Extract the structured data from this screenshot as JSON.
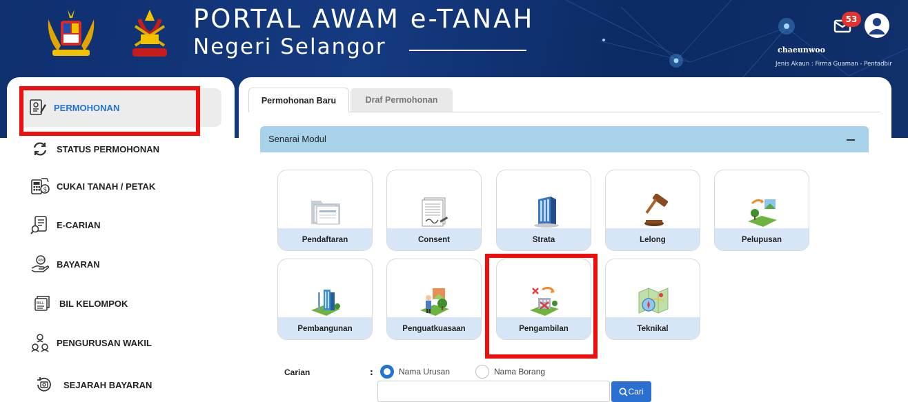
{
  "header": {
    "title": "PORTAL AWAM e-TANAH",
    "subtitle": "Negeri Selangor",
    "notification_count": "53",
    "username": "chaeunwoo",
    "account_type": "Jenis Akaun : Firma Guaman - Pentadbir"
  },
  "sidebar": {
    "items": [
      {
        "label": "PERMOHONAN",
        "icon": "application-form-icon",
        "active": true
      },
      {
        "label": "STATUS PERMOHONAN",
        "icon": "refresh-icon"
      },
      {
        "label": "CUKAI TANAH / PETAK",
        "icon": "tax-calculator-icon"
      },
      {
        "label": "E-CARIAN",
        "icon": "document-search-icon"
      },
      {
        "label": "BAYARAN",
        "icon": "payment-hand-icon"
      },
      {
        "label": "BIL KELOMPOK",
        "icon": "bill-batch-icon"
      },
      {
        "label": "PENGURUSAN WAKIL",
        "icon": "agents-icon"
      },
      {
        "label": "SEJARAH BAYARAN",
        "icon": "payment-history-icon"
      }
    ]
  },
  "tabs": [
    {
      "label": "Permohonan Baru",
      "active": true
    },
    {
      "label": "Draf Permohonan",
      "active": false
    }
  ],
  "module_panel": {
    "title": "Senarai Modul",
    "modules": [
      {
        "label": "Pendaftaran",
        "icon": "folder-documents-icon"
      },
      {
        "label": "Consent",
        "icon": "signed-document-icon"
      },
      {
        "label": "Strata",
        "icon": "building-icon"
      },
      {
        "label": "Lelong",
        "icon": "gavel-icon"
      },
      {
        "label": "Pelupusan",
        "icon": "land-disposal-icon"
      },
      {
        "label": "Pembangunan",
        "icon": "development-icon"
      },
      {
        "label": "Penguatkuasaan",
        "icon": "enforcement-icon"
      },
      {
        "label": "Pengambilan",
        "icon": "land-acquisition-icon"
      },
      {
        "label": "Teknikal",
        "icon": "technical-map-icon"
      }
    ]
  },
  "search": {
    "label": "Carian",
    "colon": ":",
    "option_1": "Nama Urusan",
    "option_2": "Nama Borang",
    "selected": "Nama Urusan",
    "input_value": "",
    "button_label": "Cari"
  },
  "colors": {
    "header_bg": "#10306c",
    "accent_blue": "#1f74d6",
    "module_bar": "#a8d2ea",
    "tile_caption": "#d7e6f7",
    "highlight_red": "#f20d0d",
    "badge_red": "#e5322d"
  }
}
